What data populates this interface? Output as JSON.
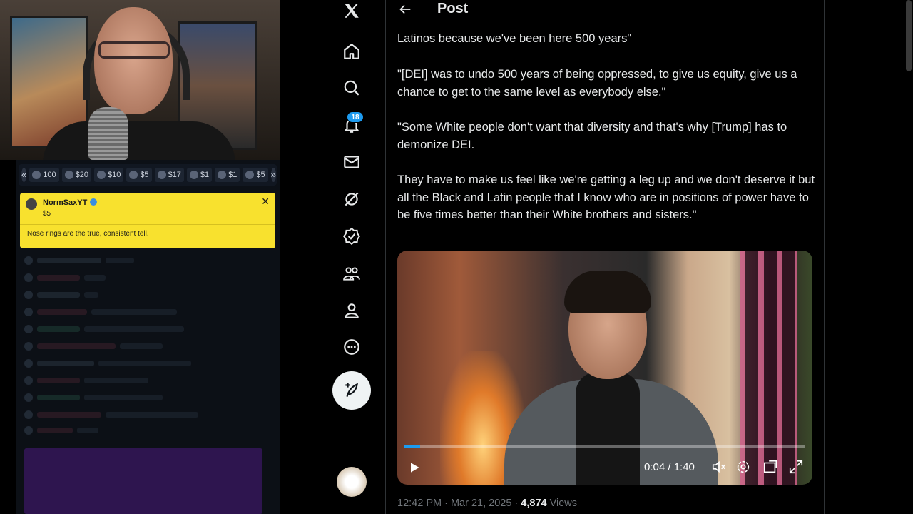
{
  "stream": {
    "tip_bar": {
      "prev_label": "«",
      "next_label": "»",
      "chips": [
        "100",
        "$20",
        "$10",
        "$5",
        "$17",
        "$1",
        "$1",
        "$5"
      ]
    },
    "superchat": {
      "username": "NormSaxYT",
      "amount": "$5",
      "close": "✕",
      "message": "Nose rings are the true, consistent tell."
    }
  },
  "nav": {
    "notification_count": "18",
    "icons": [
      "x-logo-icon",
      "home-icon",
      "search-icon",
      "bell-icon",
      "mail-icon",
      "grok-icon",
      "verified-icon",
      "communities-icon",
      "profile-icon",
      "more-icon"
    ]
  },
  "post": {
    "back": "←",
    "title": "Post",
    "paragraphs": [
      "Latinos because we've been here 500 years\"",
      "\"[DEI] was to undo 500 years of being oppressed, to give us equity, give us a chance to get to the same level as everybody else.\"",
      "\"Some White people don't want that diversity and that's why [Trump] has to demonize DEI.",
      "They have to make us feel like we're getting a leg up and we don't deserve it but all the Black and Latin people that I know who are in positions of power have to be five times better than their White brothers and sisters.\""
    ],
    "video": {
      "time": "0:04 / 1:40",
      "progress": 0.04
    },
    "meta": {
      "timestamp": "12:42 PM · Mar 21, 2025 · ",
      "views_count": "4,874",
      "views_label": " Views"
    }
  },
  "colors": {
    "accent": "#1d9bf0",
    "superchat": "#f8e12e",
    "background": "#000000",
    "text": "#e7e9ea",
    "muted": "#71767b"
  }
}
